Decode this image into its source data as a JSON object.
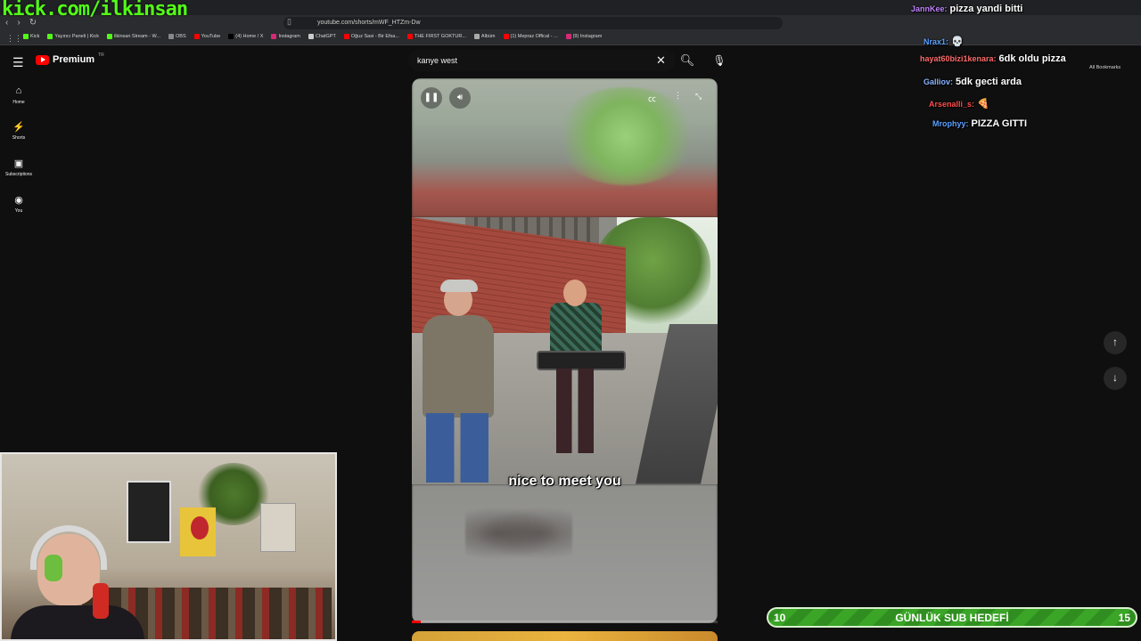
{
  "overlay": {
    "kick_url": "kick.com/ilkinsan"
  },
  "browser": {
    "url": "youtube.com/shorts/mWF_HTZm-Dw",
    "bookmarks": [
      {
        "label": "Kick",
        "color": "#53fc18"
      },
      {
        "label": "Yayıncı Paneli | Kick",
        "color": "#53fc18"
      },
      {
        "label": "ilkinsan Stream - W...",
        "color": "#53fc18"
      },
      {
        "label": "OBS",
        "color": "#888888"
      },
      {
        "label": "YouTube",
        "color": "#ff0000"
      },
      {
        "label": "(4) Home / X",
        "color": "#000000"
      },
      {
        "label": "Instagram",
        "color": "#d62976"
      },
      {
        "label": "ChatGPT",
        "color": "#cccccc"
      },
      {
        "label": "Oğuz Sasi - Bir Efsa...",
        "color": "#ff0000"
      },
      {
        "label": "THE FIRST GOKTUR...",
        "color": "#ff0000"
      },
      {
        "label": "Albüm",
        "color": "#aaaaaa"
      },
      {
        "label": "(1) Mepraz Offical - ...",
        "color": "#ff0000"
      },
      {
        "label": "(9) Instagram",
        "color": "#d62976"
      }
    ],
    "all_bookmarks": "All Bookmarks"
  },
  "youtube": {
    "brand": "Premium",
    "brand_tm": "TR",
    "search_value": "kanye west",
    "sidebar": [
      {
        "icon": "home-icon",
        "glyph": "⌂",
        "label": "Home"
      },
      {
        "icon": "shorts-icon",
        "glyph": "⚡",
        "label": "Shorts"
      },
      {
        "icon": "subscriptions-icon",
        "glyph": "▣",
        "label": "Subscriptions"
      },
      {
        "icon": "you-icon",
        "glyph": "◉",
        "label": "You"
      }
    ],
    "video": {
      "caption": "nice to meet you",
      "progress": 0.03
    }
  },
  "chat": [
    {
      "user": "JannKee:",
      "msg": "pizza yandi bitti",
      "color": "#c084fc"
    },
    {
      "user": "Nrax1:",
      "msg": "💀",
      "color": "#5aa0ff"
    },
    {
      "user": "hayat60bizi1kenara:",
      "msg": "6dk oldu pizza",
      "color": "#ff6b6b"
    },
    {
      "user": "Galliov:",
      "msg": "5dk gecti arda",
      "color": "#8ab4ff"
    },
    {
      "user": "Arsenalli_s:",
      "msg": "🍕",
      "color": "#ff4d4d"
    },
    {
      "user": "Mrophyy:",
      "msg": "PIZZA GITTI",
      "color": "#5aa0ff"
    }
  ],
  "subgoal": {
    "current": "10",
    "title": "GÜNLÜK SUB HEDEFİ",
    "target": "15"
  }
}
